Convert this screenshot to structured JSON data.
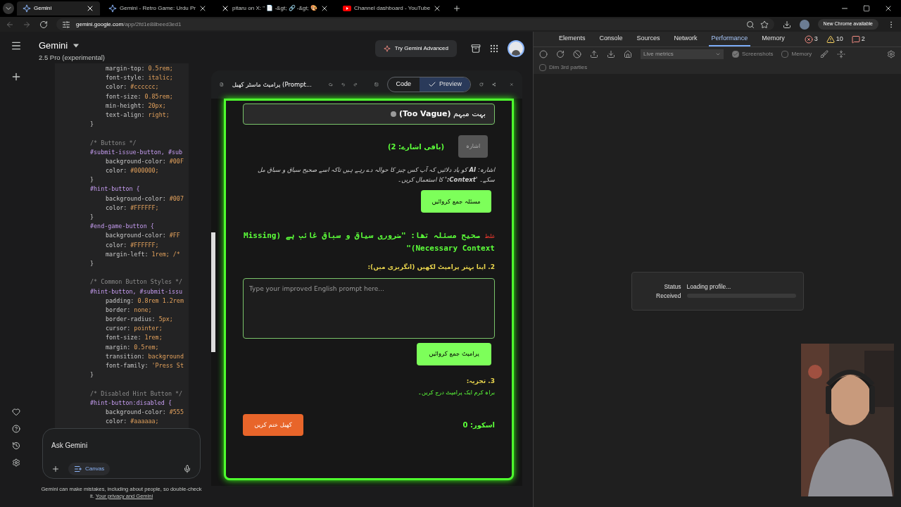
{
  "browser": {
    "tabs": [
      {
        "title": "Gemini",
        "kind": "gemini",
        "selected": true
      },
      {
        "title": "Gemini - Retro Game: Urdu Pr",
        "kind": "gemini",
        "selected": false
      },
      {
        "title": "pitaru on X: \" 📄 -&gt; 🔗 -&gt; 🎨",
        "kind": "x",
        "selected": false
      },
      {
        "title": "Channel dashboard - YouTube",
        "kind": "youtube",
        "selected": false
      }
    ],
    "url_host": "gemini.google.com",
    "url_path": "/app/2fd1e88beed3ed1",
    "update_button": "New Chrome available"
  },
  "gemini": {
    "title": "Gemini",
    "model": "2.5 Pro (experimental)",
    "advanced_button": "Try Gemini Advanced",
    "code_lines": [
      {
        "kind": "prop",
        "prop": "margin-top:",
        "value": "0.5rem;"
      },
      {
        "kind": "prop",
        "prop": "font-style:",
        "value": "italic;"
      },
      {
        "kind": "prop",
        "prop": "color:",
        "value": "#cccccc;"
      },
      {
        "kind": "prop",
        "prop": "font-size:",
        "value": "0.85rem;"
      },
      {
        "kind": "prop",
        "prop": "min-height:",
        "value": "20px;"
      },
      {
        "kind": "prop",
        "prop": "text-align:",
        "value": "right;"
      },
      {
        "kind": "brace",
        "text": "}"
      },
      {
        "kind": "blank"
      },
      {
        "kind": "comment",
        "text": "/* Buttons */"
      },
      {
        "kind": "selector",
        "text": "#submit-issue-button, #sub"
      },
      {
        "kind": "prop",
        "prop": "background-color:",
        "value": "#00F"
      },
      {
        "kind": "prop",
        "prop": "color:",
        "value": "#000000;"
      },
      {
        "kind": "brace",
        "text": "}"
      },
      {
        "kind": "selector",
        "text": "#hint-button {"
      },
      {
        "kind": "prop",
        "prop": "background-color:",
        "value": "#007"
      },
      {
        "kind": "prop",
        "prop": "color:",
        "value": "#FFFFFF;"
      },
      {
        "kind": "brace",
        "text": "}"
      },
      {
        "kind": "selector",
        "text": "#end-game-button {"
      },
      {
        "kind": "prop",
        "prop": "background-color:",
        "value": "#FF"
      },
      {
        "kind": "prop",
        "prop": "color:",
        "value": "#FFFFFF;"
      },
      {
        "kind": "prop",
        "prop": "margin-left:",
        "value": "1rem; /*"
      },
      {
        "kind": "brace",
        "text": "}"
      },
      {
        "kind": "blank"
      },
      {
        "kind": "comment",
        "text": "/* Common Button Styles */"
      },
      {
        "kind": "selector",
        "text": "#hint-button, #submit-issu"
      },
      {
        "kind": "prop",
        "prop": "padding:",
        "value": "0.8rem 1.2rem"
      },
      {
        "kind": "prop",
        "prop": "border:",
        "value": "none;"
      },
      {
        "kind": "prop",
        "prop": "border-radius:",
        "value": "5px;"
      },
      {
        "kind": "prop",
        "prop": "cursor:",
        "value": "pointer;"
      },
      {
        "kind": "prop",
        "prop": "font-size:",
        "value": "1rem;"
      },
      {
        "kind": "prop",
        "prop": "margin:",
        "value": "0.5rem;"
      },
      {
        "kind": "prop",
        "prop": "transition:",
        "value": "background"
      },
      {
        "kind": "prop",
        "prop": "font-family:",
        "value": "'Press St"
      },
      {
        "kind": "brace",
        "text": "}"
      },
      {
        "kind": "blank"
      },
      {
        "kind": "comment",
        "text": "/* Disabled Hint Button */"
      },
      {
        "kind": "selector",
        "text": "#hint-button:disabled {"
      },
      {
        "kind": "prop",
        "prop": "background-color:",
        "value": "#555"
      },
      {
        "kind": "prop",
        "prop": "color:",
        "value": "#aaaaaa;"
      }
    ],
    "prompt_placeholder": "Ask Gemini",
    "canvas_button": "Canvas",
    "disclaimer": "Gemini can make mistakes, including about people, so double-check it.",
    "privacy_link": "Your privacy and Gemini"
  },
  "preview": {
    "title": "پرامپٹ ماسٹر کھیل (Prompt...",
    "modes": [
      {
        "label": "Code",
        "selected": false
      },
      {
        "label": "Preview",
        "selected": true
      }
    ],
    "feedback": "بہت مبہم **(Too Vague)**",
    "hint_button": {
      "label": "اشارہ",
      "disabled": true
    },
    "hints_left": "(باقی اشارے: 2)",
    "hint_text": "اشارہ: **AI** کو یاد دلائیں کہ آپ کس چیز کا حوالہ دے رہے ہیں تاکہ اسے صحیح سیاق و سباق مل سکے۔ **'Context:'** کا استعمال کریں۔",
    "submit_issue": "مسئلہ جمع کروائیں",
    "verdict": "غلط",
    "correct_issue": "صحیح مسئلہ تھا: \"ضروری سیاق و سباق غائب ہے (Missing Necessary Context)\"",
    "step2": "2. اپنا بہتر پرامپٹ لکھیں (انگریزی میں):",
    "prompt_field_placeholder": "Type your improved English prompt here...",
    "submit_prompt": "پرامپٹ جمع کروائیں",
    "step3": "3. تجزیہ:",
    "analysis": "براہ کرم ایک پرامپٹ درج کریں۔",
    "end_game": "کھیل ختم کریں",
    "score": "اسکور: 0"
  },
  "devtools": {
    "tabs": [
      {
        "label": "Elements",
        "selected": false
      },
      {
        "label": "Console",
        "selected": false
      },
      {
        "label": "Sources",
        "selected": false
      },
      {
        "label": "Network",
        "selected": false
      },
      {
        "label": "Performance",
        "selected": true
      },
      {
        "label": "Memory",
        "selected": false
      }
    ],
    "errors": "3",
    "warnings": "10",
    "issues": "2",
    "metrics_select": "Live metrics",
    "options": [
      {
        "label": "Screenshots",
        "checked": true
      },
      {
        "label": "Memory",
        "checked": false
      }
    ],
    "dim_third_parties": {
      "label": "Dim 3rd parties",
      "checked": false
    },
    "status_label": "Status",
    "status_value": "Loading profile...",
    "received_label": "Received",
    "received": {
      "level": 0
    }
  }
}
